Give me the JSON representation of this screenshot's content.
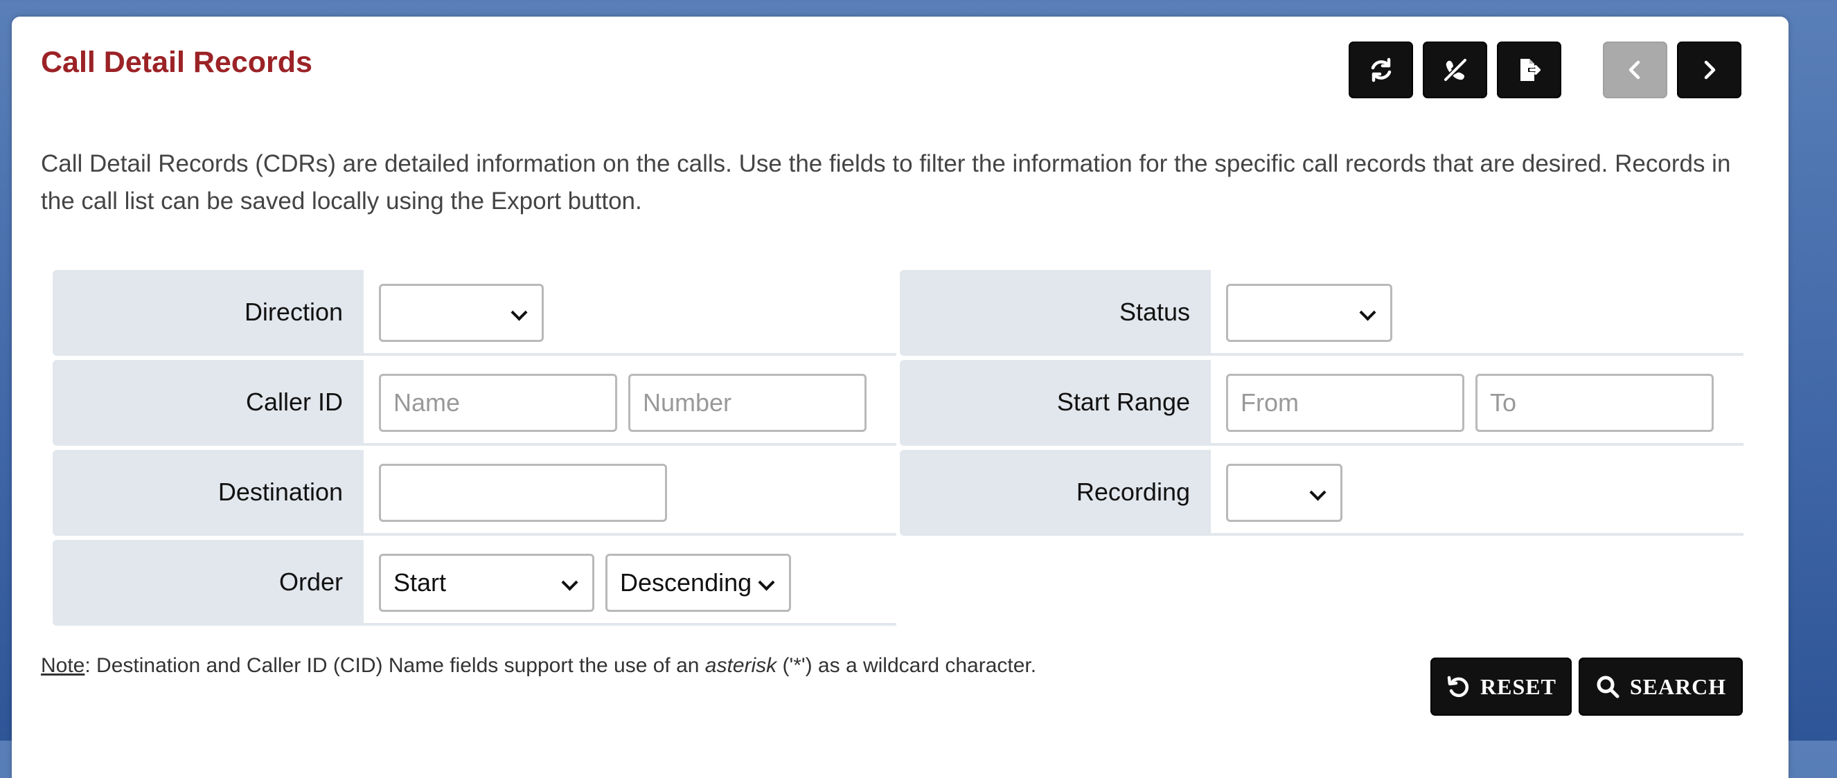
{
  "page": {
    "title": "Call Detail Records",
    "description": "Call Detail Records (CDRs) are detailed information on the calls. Use the fields to filter the information for the specific call records that are desired. Records in the call list can be saved locally using the Export button."
  },
  "toolbar": {
    "refresh_icon": "refresh-icon",
    "hangup_icon": "phone-slash-icon",
    "export_icon": "export-file-icon",
    "prev_icon": "chevron-left-icon",
    "next_icon": "chevron-right-icon"
  },
  "filters": {
    "direction": {
      "label": "Direction",
      "value": ""
    },
    "status": {
      "label": "Status",
      "value": ""
    },
    "caller_id": {
      "label": "Caller ID",
      "name_placeholder": "Name",
      "number_placeholder": "Number"
    },
    "start_range": {
      "label": "Start Range",
      "from_placeholder": "From",
      "to_placeholder": "To"
    },
    "destination": {
      "label": "Destination",
      "value": ""
    },
    "recording": {
      "label": "Recording",
      "value": ""
    },
    "order": {
      "label": "Order",
      "field_value": "Start",
      "direction_value": "Descending"
    }
  },
  "note": {
    "prefix": "Note",
    "text_before": ": Destination and Caller ID (CID) Name fields support the use of an ",
    "emphasis": "asterisk",
    "text_after": " ('*') as a wildcard character."
  },
  "actions": {
    "reset_label": "RESET",
    "search_label": "SEARCH"
  },
  "colors": {
    "title": "#9b2226",
    "label_bg": "#e2e7ed",
    "button_bg": "#111111",
    "disabled_button_bg": "#aaaaaa",
    "background": "#3f66a6"
  }
}
